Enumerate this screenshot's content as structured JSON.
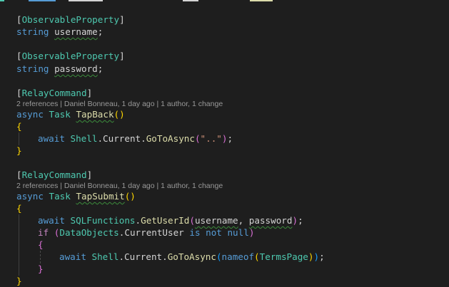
{
  "code": {
    "attr_observable": "ObservableProperty",
    "attr_relay": "RelayCommand",
    "kw_string": "string",
    "kw_async": "async",
    "kw_await": "await",
    "kw_if": "if",
    "kw_is": "is",
    "kw_not": "not",
    "kw_null": "null",
    "kw_nameof": "nameof",
    "type_task": "Task",
    "type_shell": "Shell",
    "type_sqlfunctions": "SQLFunctions",
    "type_dataobjects": "DataObjects",
    "field_username": "username",
    "field_password": "password",
    "method_tapback": "TapBack",
    "method_tapsubmit": "TapSubmit",
    "member_current": "Current",
    "member_currentuser": "CurrentUser",
    "call_gotoasync": "GoToAsync",
    "call_getuserid": "GetUserId",
    "string_dotdot": "\"..\"",
    "type_termspage": "TermsPage",
    "codelens": "2 references | Daniel Bonneau, 1 day ago | 1 author, 1 change"
  },
  "theme": {
    "background": "#1e1e1e",
    "attribute_color": "#4ec9b0",
    "keyword_color": "#569cd6",
    "control_keyword_color": "#c586c0",
    "method_color": "#dcdcaa",
    "string_color": "#ce9178",
    "codelens_color": "#999999",
    "bracket_level1": "#ffd700",
    "bracket_level2": "#da70d6",
    "bracket_level3": "#179fff"
  }
}
